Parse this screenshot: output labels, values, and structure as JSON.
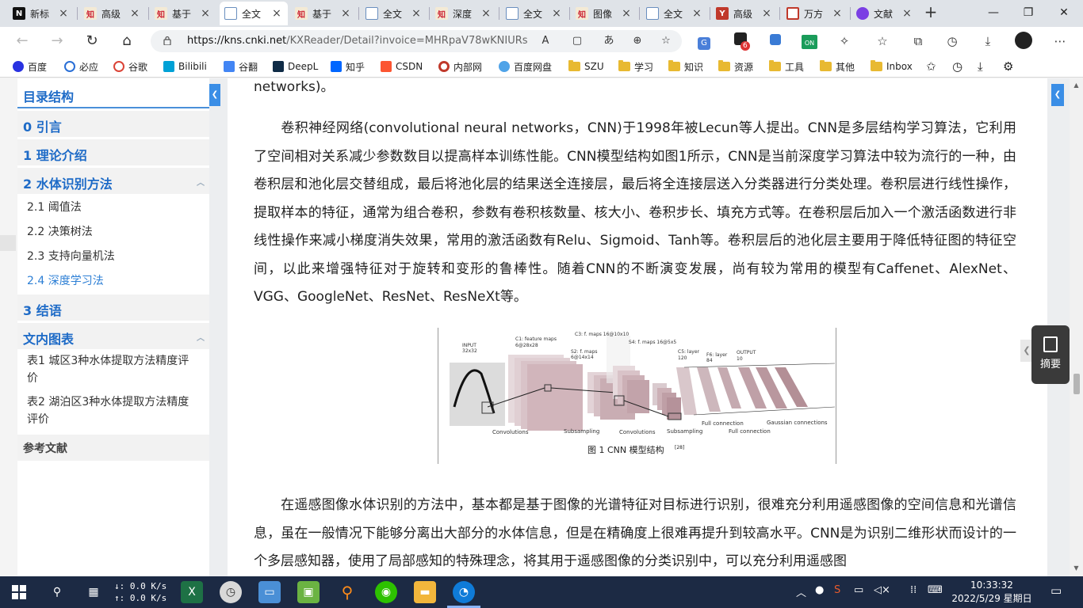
{
  "browser": {
    "tabs": [
      {
        "title": "新标",
        "icon": "notion-icon",
        "active": false
      },
      {
        "title": "高级",
        "icon": "cnki-icon",
        "active": false
      },
      {
        "title": "基于",
        "icon": "cnki-icon",
        "active": false
      },
      {
        "title": "全文",
        "icon": "document-icon",
        "active": true
      },
      {
        "title": "基于",
        "icon": "cnki-icon",
        "active": false
      },
      {
        "title": "全文",
        "icon": "document-icon",
        "active": false
      },
      {
        "title": "深度",
        "icon": "cnki-icon",
        "active": false
      },
      {
        "title": "全文",
        "icon": "document-icon",
        "active": false
      },
      {
        "title": "图像",
        "icon": "cnki-icon",
        "active": false
      },
      {
        "title": "全文",
        "icon": "document-icon",
        "active": false
      },
      {
        "title": "高级",
        "icon": "wanfang-icon",
        "active": false
      },
      {
        "title": "万方",
        "icon": "wanfang-grid-icon",
        "active": false
      },
      {
        "title": "文献",
        "icon": "copilot-icon",
        "active": false
      }
    ],
    "address": {
      "host": "https://kns.cnki.net",
      "path": "/KXReader/Detail?invoice=MHRpaV78wKNIURsnJ..."
    },
    "extension_badge": "6",
    "extension_on_label": "ON",
    "bookmarks": [
      {
        "label": "百度",
        "icon": "baidu-icon"
      },
      {
        "label": "必应",
        "icon": "bing-search-icon"
      },
      {
        "label": "谷歌",
        "icon": "google-icon"
      },
      {
        "label": "Bilibili",
        "icon": "bilibili-icon"
      },
      {
        "label": "谷翻",
        "icon": "google-translate-icon"
      },
      {
        "label": "DeepL",
        "icon": "deepl-icon"
      },
      {
        "label": "知乎",
        "icon": "zhihu-icon"
      },
      {
        "label": "CSDN",
        "icon": "csdn-icon"
      },
      {
        "label": "内部网",
        "icon": "intranet-icon"
      },
      {
        "label": "百度网盘",
        "icon": "baidu-pan-icon"
      },
      {
        "label": "SZU",
        "icon": "folder-icon"
      },
      {
        "label": "学习",
        "icon": "folder-icon"
      },
      {
        "label": "知识",
        "icon": "folder-icon"
      },
      {
        "label": "资源",
        "icon": "folder-icon"
      },
      {
        "label": "工具",
        "icon": "folder-icon"
      },
      {
        "label": "其他",
        "icon": "folder-icon"
      },
      {
        "label": "Inbox",
        "icon": "folder-icon"
      }
    ]
  },
  "toc": {
    "title": "目录结构",
    "sections": [
      {
        "label": "0 引言"
      },
      {
        "label": "1 理论介绍"
      },
      {
        "label": "2 水体识别方法",
        "children": [
          {
            "label": "2.1 阈值法"
          },
          {
            "label": "2.2 决策树法"
          },
          {
            "label": "2.3 支持向量机法"
          },
          {
            "label": "2.4 深度学习法",
            "active": true
          }
        ]
      },
      {
        "label": "3 结语"
      },
      {
        "label": "文内图表",
        "children": [
          {
            "label": "表1 城区3种水体提取方法精度评价"
          },
          {
            "label": "表2 湖泊区3种水体提取方法精度评价"
          }
        ]
      }
    ],
    "references": "参考文献"
  },
  "article": {
    "fragment": "networks)。",
    "para1": "卷积神经网络(convolutional neural networks，CNN)于1998年被Lecun等人提出。CNN是多层结构学习算法，它利用了空间相对关系减少参数数目以提高样本训练性能。CNN模型结构如图1所示，CNN是当前深度学习算法中较为流行的一种，由卷积层和池化层交替组成，最后将池化层的结果送全连接层，最后将全连接层送入分类器进行分类处理。卷积层进行线性操作，提取样本的特征，通常为组合卷积，参数有卷积核数量、核大小、卷积步长、填充方式等。在卷积层后加入一个激活函数进行非线性操作来减小梯度消失效果，常用的激活函数有Relu、Sigmoid、Tanh等。卷积层后的池化层主要用于降低特征图的特征空间，以此来增强特征对于旋转和变形的鲁棒性。随着CNN的不断演变发展，尚有较为常用的模型有Caffenet、AlexNet、VGG、GoogleNet、ResNet、ResNeXt等。",
    "para2": "在遥感图像水体识别的方法中，基本都是基于图像的光谱特征对目标进行识别，很难充分利用遥感图像的空间信息和光谱信息，虽在一般情况下能够分离出大部分的水体信息，但是在精确度上很难再提升到较高水平。CNN是为识别二维形状而设计的一个多层感知器，使用了局部感知的特殊理念，将其用于遥感图像的分类识别中，可以充分利用遥感图",
    "figure": {
      "caption": "图 1 CNN 模型结构",
      "caption_ref": "[28]",
      "labels": {
        "input": "INPUT",
        "input_size": "32x32",
        "c1": "C1: feature maps",
        "c1_size": "6@28x28",
        "s2": "S2: f. maps",
        "s2_size": "6@14x14",
        "c3": "C3: f. maps 16@10x10",
        "s4": "S4: f. maps 16@5x5",
        "c5": "C5: layer",
        "c5_size": "120",
        "f6": "F6: layer",
        "f6_size": "84",
        "output": "OUTPUT",
        "output_size": "10",
        "convolutions1": "Convolutions",
        "subsampling1": "Subsampling",
        "convolutions2": "Convolutions",
        "subsampling2": "Subsampling",
        "full_connection1": "Full connection",
        "full_connection2": "Full connection",
        "gaussian": "Gaussian connections"
      }
    }
  },
  "abstract_button": "摘要",
  "taskbar": {
    "net_down": "↓: 0.0 K/s",
    "net_up": "↑: 0.0 K/s",
    "time": "10:33:32",
    "date": "2022/5/29 星期日"
  }
}
